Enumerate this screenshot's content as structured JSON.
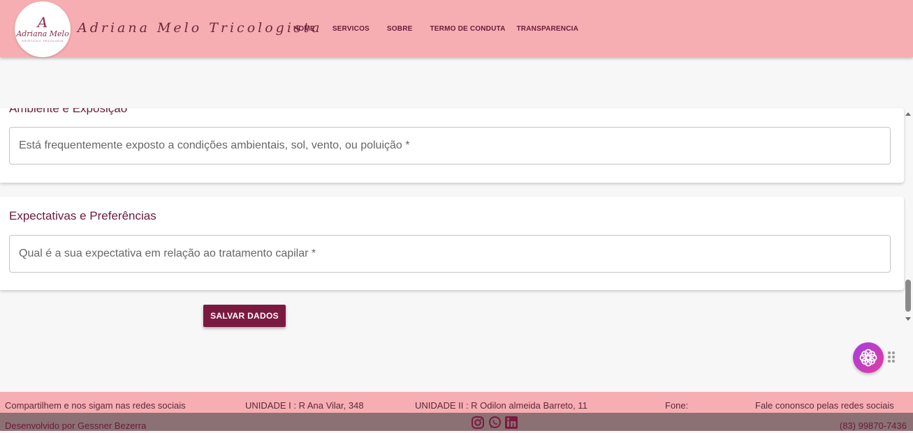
{
  "brand": {
    "logo_mark": "A",
    "logo_name": "Adriana Melo",
    "logo_sub": "ESTÉTICA E TRICOLOGIA",
    "title": "Adriana Melo Tricologista"
  },
  "nav": {
    "items": [
      "HOME",
      "SERVICOS",
      "SOBRE",
      "TERMO DE CONDUTA",
      "TRANSPARENCIA"
    ]
  },
  "sections": [
    {
      "title": "Ambiente e Exposição",
      "field_label": "Está frequentemente exposto a condições ambientais, sol, vento, ou poluição *"
    },
    {
      "title": "Expectativas e Preferências",
      "field_label": "Qual é a sua expectativa em relação ao tratamento capilar *"
    }
  ],
  "save_button": "SALVAR DADOS",
  "footer": {
    "share": "Compartilhem e nos sigam nas redes sociais",
    "unit1": "UNIDADE I : R Ana Vilar, 348",
    "unit2": "UNIDADE II : R Odilon almeida Barreto, 11",
    "phone_label": "Fone:",
    "contact": "Fale cononsco pelas redes sociais",
    "developer": "Desenvolvido por Gessner Bezerra",
    "phone": "(83) 99870-7436",
    "social_icons": [
      "instagram-icon",
      "whatsapp-icon",
      "linkedin-icon"
    ]
  },
  "colors": {
    "header_bg": "#f7aeb2",
    "accent": "#7b1a40",
    "footer_bottom_bg": "#8b7174"
  }
}
